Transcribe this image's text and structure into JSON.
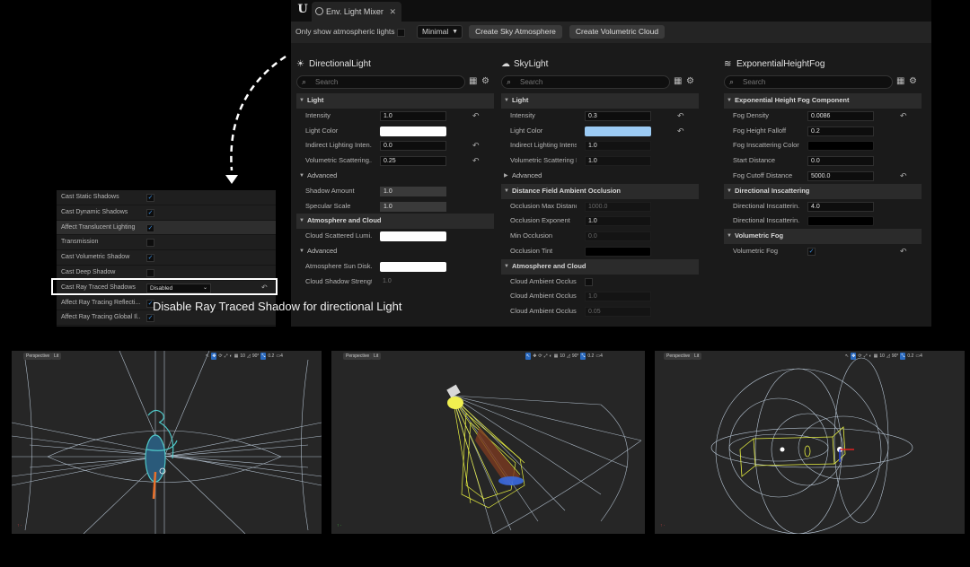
{
  "mixer": {
    "tab_title": "Env. Light Mixer",
    "only_show_label": "Only show atmospheric lights",
    "mode_value": "Minimal",
    "create_sky_btn": "Create Sky Atmosphere",
    "create_cloud_btn": "Create Volumetric Cloud",
    "search_placeholder": "Search",
    "columns": [
      {
        "title": "DirectionalLight",
        "rows": [
          {
            "kind": "section",
            "label": "Light"
          },
          {
            "kind": "prop",
            "name": "Intensity",
            "value": "1.0",
            "reset": true
          },
          {
            "kind": "prop",
            "name": "Light Color",
            "swatch": "#ffffff"
          },
          {
            "kind": "prop",
            "name": "Indirect Lighting Inten...",
            "value": "0.0",
            "reset": true
          },
          {
            "kind": "prop",
            "name": "Volumetric Scattering...",
            "value": "0.25",
            "reset": true
          },
          {
            "kind": "sub",
            "label": "Advanced"
          },
          {
            "kind": "prop",
            "name": "Shadow Amount",
            "value": "1.0",
            "style": "slider"
          },
          {
            "kind": "prop",
            "name": "Specular Scale",
            "value": "1.0",
            "style": "slider"
          },
          {
            "kind": "section",
            "label": "Atmosphere and Cloud"
          },
          {
            "kind": "prop",
            "name": "Cloud Scattered Lumi...",
            "swatch": "#ffffff"
          },
          {
            "kind": "sub",
            "label": "Advanced"
          },
          {
            "kind": "prop",
            "name": "Atmosphere Sun Disk...",
            "swatch": "#ffffff"
          },
          {
            "kind": "prop",
            "name": "Cloud Shadow Strength",
            "value": "1.0",
            "style": "plain"
          }
        ]
      },
      {
        "title": "SkyLight",
        "rows": [
          {
            "kind": "section",
            "label": "Light"
          },
          {
            "kind": "prop",
            "name": "Intensity",
            "value": "0.3",
            "reset": true
          },
          {
            "kind": "prop",
            "name": "Light Color",
            "swatch": "#9ccbf4",
            "reset": true
          },
          {
            "kind": "prop",
            "name": "Indirect Lighting Intensity",
            "value": "1.0",
            "style": "slider-dark"
          },
          {
            "kind": "prop",
            "name": "Volumetric Scattering Int...",
            "value": "1.0",
            "style": "slider-dark"
          },
          {
            "kind": "sub",
            "label": "Advanced",
            "collapsed": true
          },
          {
            "kind": "section",
            "label": "Distance Field Ambient Occlusion"
          },
          {
            "kind": "prop",
            "name": "Occlusion Max Distance",
            "value": "1000.0",
            "style": "dim"
          },
          {
            "kind": "prop",
            "name": "Occlusion Exponent",
            "value": "1.0",
            "style": "slider-dark"
          },
          {
            "kind": "prop",
            "name": "Min Occlusion",
            "value": "0.0",
            "style": "dim"
          },
          {
            "kind": "prop",
            "name": "Occlusion Tint",
            "swatch": "#000000"
          },
          {
            "kind": "section",
            "label": "Atmosphere and Cloud"
          },
          {
            "kind": "prop",
            "name": "Cloud Ambient Occlusion",
            "check": ""
          },
          {
            "kind": "prop",
            "name": "Cloud Ambient Occlusion...",
            "value": "1.0",
            "style": "dim"
          },
          {
            "kind": "prop",
            "name": "Cloud Ambient Occlusion...",
            "value": "0.05",
            "style": "dim"
          }
        ]
      },
      {
        "title": "ExponentialHeightFog",
        "rows": [
          {
            "kind": "section",
            "label": "Exponential Height Fog Component"
          },
          {
            "kind": "prop",
            "name": "Fog Density",
            "value": "0.0086",
            "reset": true
          },
          {
            "kind": "prop",
            "name": "Fog Height Falloff",
            "value": "0.2"
          },
          {
            "kind": "prop",
            "name": "Fog Inscattering Color",
            "swatch": "#000000"
          },
          {
            "kind": "prop",
            "name": "Start Distance",
            "value": "0.0"
          },
          {
            "kind": "prop",
            "name": "Fog Cutoff Distance",
            "value": "5000.0",
            "reset": true
          },
          {
            "kind": "section",
            "label": "Directional Inscattering"
          },
          {
            "kind": "prop",
            "name": "Directional Inscatterin...",
            "value": "4.0"
          },
          {
            "kind": "prop",
            "name": "Directional Inscatterin...",
            "swatch": "#000000"
          },
          {
            "kind": "section",
            "label": "Volumetric Fog"
          },
          {
            "kind": "prop",
            "name": "Volumetric Fog",
            "check": "✓",
            "reset": true
          }
        ]
      }
    ]
  },
  "details": {
    "rows": [
      {
        "name": "Cast Static Shadows",
        "check": "✓"
      },
      {
        "name": "Cast Dynamic Shadows",
        "check": "✓"
      },
      {
        "name": "Affect Translucent Lighting",
        "check": "✓",
        "highlight": true
      },
      {
        "name": "Transmission",
        "check": ""
      },
      {
        "name": "Cast Volumetric Shadow",
        "check": "✓"
      },
      {
        "name": "Cast Deep Shadow",
        "check": ""
      },
      {
        "name": "Cast Ray Traced Shadows",
        "combo": "Disabled",
        "reset": true
      },
      {
        "name": "Affect Ray Tracing Reflecti...",
        "check": "✓"
      },
      {
        "name": "Affect Ray Tracing Global Il...",
        "check": "✓"
      }
    ]
  },
  "caption": "Disable Ray Traced Shadow for directional Light",
  "viewports": [
    {
      "view": "Perspective",
      "mode": "Lit"
    },
    {
      "view": "Perspective",
      "mode": "Lit"
    },
    {
      "view": "Perspective",
      "mode": "Lit"
    }
  ],
  "colors": {
    "accent": "#3c8fe0",
    "skylight_color": "#9ccbf4",
    "wire": "#c8d8e8",
    "wire_yellow": "#e8f040",
    "cyan_helper": "#4fc8c8"
  }
}
